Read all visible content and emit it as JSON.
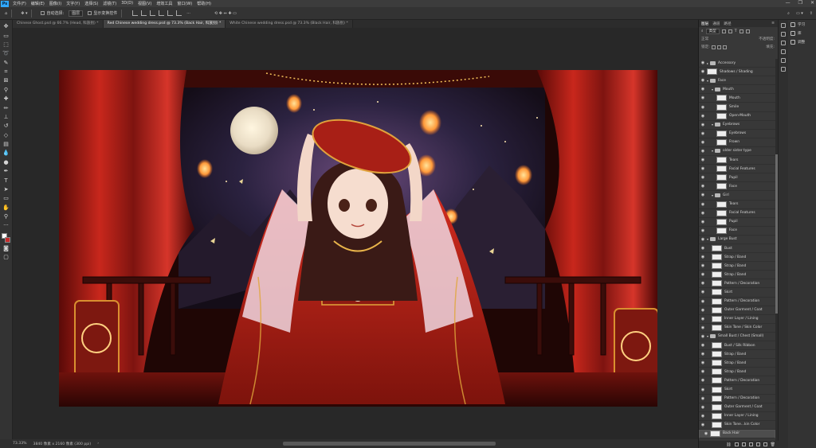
{
  "app": {
    "logo": "Ps"
  },
  "menu": [
    "文件(F)",
    "编辑(E)",
    "图像(I)",
    "文字(Y)",
    "选择(S)",
    "滤镜(T)",
    "3D(D)",
    "视图(V)",
    "增效工具",
    "窗口(W)",
    "帮助(H)"
  ],
  "window_controls": {
    "minimize": "—",
    "maximize": "❐",
    "close": "✕"
  },
  "options": {
    "auto_select_label": "自动选择:",
    "auto_select_value": "图层",
    "transform_label": "显示变换控件"
  },
  "tabs": [
    {
      "label": "Chinese Ghost.psd @ 66.7% (Head, 科族别) *",
      "active": false
    },
    {
      "label": "Red Chinese wedding dress.psd @ 73.3% (Back Hair, 科族别) *",
      "active": true
    },
    {
      "label": "White Chinese wedding dress.psd @ 73.3% (Black Hair, 科族别) *",
      "active": false
    }
  ],
  "status": {
    "zoom": "73.33%",
    "doc_info": "3840 像素 x 2160 像素 (300 ppi)"
  },
  "layers_panel": {
    "tabs": [
      "图层",
      "通道",
      "路径"
    ],
    "active_tab": "图层",
    "kind_filter": "类型",
    "blend_mode": "正常",
    "opacity_label": "不透明度:",
    "lock_label": "锁定:",
    "fill_label": "填充:",
    "layers": [
      {
        "name": "Accessory",
        "type": "folder",
        "depth": 0
      },
      {
        "name": "Shadows / Shading",
        "type": "layer",
        "depth": 0
      },
      {
        "name": "Face",
        "type": "folder",
        "depth": 0,
        "open": true
      },
      {
        "name": "Mouth",
        "type": "folder",
        "depth": 1,
        "open": true
      },
      {
        "name": "Mouth",
        "type": "layer",
        "depth": 2
      },
      {
        "name": "Smile",
        "type": "layer",
        "depth": 2
      },
      {
        "name": "Open-Mouth",
        "type": "layer",
        "depth": 2
      },
      {
        "name": "Eyebrows",
        "type": "folder",
        "depth": 1,
        "open": true
      },
      {
        "name": "Eyebrows",
        "type": "layer",
        "depth": 2
      },
      {
        "name": "Frown",
        "type": "layer",
        "depth": 2
      },
      {
        "name": "older sister type",
        "type": "folder",
        "depth": 1,
        "open": true
      },
      {
        "name": "Tears",
        "type": "layer",
        "depth": 2
      },
      {
        "name": "Facial Features",
        "type": "layer",
        "depth": 2
      },
      {
        "name": "Pupil",
        "type": "layer",
        "depth": 2
      },
      {
        "name": "Face",
        "type": "layer",
        "depth": 2
      },
      {
        "name": "Girl",
        "type": "folder",
        "depth": 1,
        "open": true
      },
      {
        "name": "Tears",
        "type": "layer",
        "depth": 2
      },
      {
        "name": "Facial Features",
        "type": "layer",
        "depth": 2
      },
      {
        "name": "Pupil",
        "type": "layer",
        "depth": 2
      },
      {
        "name": "Face",
        "type": "layer",
        "depth": 2
      },
      {
        "name": "Large Bust",
        "type": "folder",
        "depth": 0,
        "open": true
      },
      {
        "name": "Bust",
        "type": "layer",
        "depth": 1
      },
      {
        "name": "Strap / Band",
        "type": "layer",
        "depth": 1
      },
      {
        "name": "Strap / Band",
        "type": "layer",
        "depth": 1
      },
      {
        "name": "Strap / Band",
        "type": "layer",
        "depth": 1
      },
      {
        "name": "Pattern / Decoration",
        "type": "layer",
        "depth": 1
      },
      {
        "name": "Skirt",
        "type": "layer",
        "depth": 1
      },
      {
        "name": "Pattern / Decoration",
        "type": "layer",
        "depth": 1
      },
      {
        "name": "Outer Garment / Coat",
        "type": "layer",
        "depth": 1
      },
      {
        "name": "Inner Layer / Lining",
        "type": "layer",
        "depth": 1
      },
      {
        "name": "Skin Tone / Skin Color",
        "type": "layer",
        "depth": 1
      },
      {
        "name": "Small Bust / Chest (Small)",
        "type": "folder",
        "depth": 0,
        "open": true
      },
      {
        "name": "Bust / Silk Ribbon",
        "type": "layer",
        "depth": 1
      },
      {
        "name": "Strap / Band",
        "type": "layer",
        "depth": 1
      },
      {
        "name": "Strap / Band",
        "type": "layer",
        "depth": 1
      },
      {
        "name": "Strap / Band",
        "type": "layer",
        "depth": 1
      },
      {
        "name": "Pattern / Decoration",
        "type": "layer",
        "depth": 1
      },
      {
        "name": "Skirt",
        "type": "layer",
        "depth": 1
      },
      {
        "name": "Pattern / Decoration",
        "type": "layer",
        "depth": 1
      },
      {
        "name": "Outer Garment / Coat",
        "type": "layer",
        "depth": 1
      },
      {
        "name": "Inner Layer / Lining",
        "type": "layer",
        "depth": 1
      },
      {
        "name": "Skin Tone...kin Color",
        "type": "layer",
        "depth": 1
      },
      {
        "name": "Back Hair",
        "type": "layer",
        "depth": 0,
        "selected": true
      }
    ]
  },
  "side_panels": [
    "学习",
    "库",
    "调整"
  ],
  "colors": {
    "accent": "#31a8ff",
    "background_swatch": "#c62b2b"
  }
}
